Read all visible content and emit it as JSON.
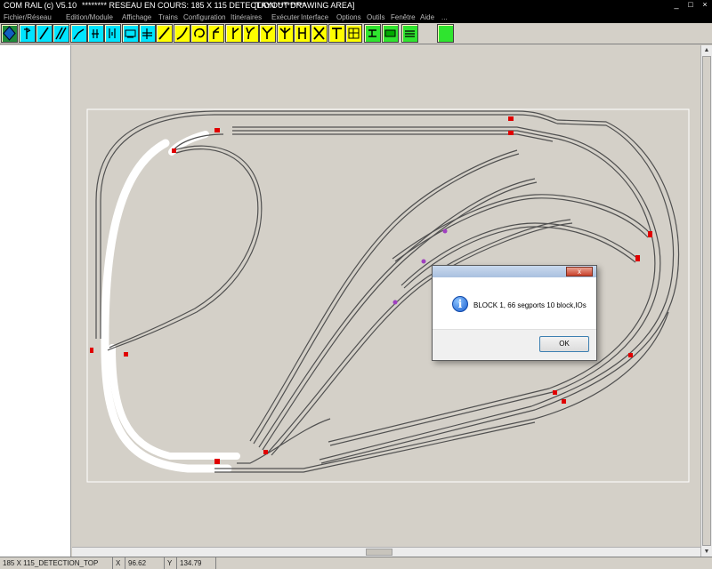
{
  "window": {
    "app_title": "COM RAIL (c) V5.10",
    "network_title": "******** RESEAU EN COURS: 185 X 115 DETECTION *********",
    "area_title": "[LAYOUT DRAWING AREA]",
    "min_glyph": "_",
    "max_glyph": "□",
    "close_glyph": "×"
  },
  "menu": {
    "items": [
      "Fichier/Réseau",
      "Edition/Module",
      "Affichage",
      "Trains",
      "Configuration",
      "Itinéraires",
      "Exécuter",
      "Interface",
      "Options",
      "Outils",
      "Fenêtre",
      "Aide",
      "..."
    ]
  },
  "toolbar": {
    "tools": [
      {
        "icon": "diamond-select-icon",
        "color": "#1e8c3a"
      },
      {
        "icon": "signal-pole-icon",
        "color": "#00e5ff"
      },
      {
        "icon": "diagonal-track-icon",
        "color": "#00e5ff"
      },
      {
        "icon": "double-track-icon",
        "color": "#00e5ff"
      },
      {
        "icon": "bend-track-icon",
        "color": "#00e5ff"
      },
      {
        "icon": "uncoupler-icon",
        "color": "#00e5ff"
      },
      {
        "icon": "isolator-icon",
        "color": "#00e5ff"
      },
      {
        "icon": "locomotive-icon",
        "color": "#00e5ff"
      },
      {
        "icon": "level-crossing-icon",
        "color": "#00e5ff"
      },
      {
        "icon": "straight-track-icon",
        "color": "#ffff00"
      },
      {
        "icon": "curve-track-icon",
        "color": "#ffff00"
      },
      {
        "icon": "loop-track-icon",
        "color": "#ffff00"
      },
      {
        "icon": "left-turnout-icon",
        "color": "#ffff00"
      },
      {
        "icon": "right-turnout-icon",
        "color": "#ffff00"
      },
      {
        "icon": "curved-turnout-icon",
        "color": "#ffff00"
      },
      {
        "icon": "y-turnout-icon",
        "color": "#ffff00"
      },
      {
        "icon": "three-way-turnout-icon",
        "color": "#ffff00"
      },
      {
        "icon": "double-slip-icon",
        "color": "#ffff00"
      },
      {
        "icon": "crossing-icon",
        "color": "#ffff00"
      },
      {
        "icon": "bumper-icon",
        "color": "#ffff00"
      },
      {
        "icon": "turntable-icon",
        "color": "#ffff00"
      },
      {
        "icon": "route-icon",
        "color": "#2fe42f"
      },
      {
        "icon": "block-icon",
        "color": "#2fe42f"
      },
      {
        "icon": "layer-icon",
        "color": "#2fe42f"
      },
      {
        "icon": "blank-tool-icon",
        "color": "#2fe42f"
      }
    ]
  },
  "dialog": {
    "close_glyph": "x",
    "message": "BLOCK 1, 66 segports 10 block,IOs",
    "ok_label": "OK"
  },
  "statusbar": {
    "layer": "185 X 115_DETECTION_TOP",
    "x_label": "X",
    "x_value": "96.62",
    "y_label": "Y",
    "y_value": "134.79"
  }
}
